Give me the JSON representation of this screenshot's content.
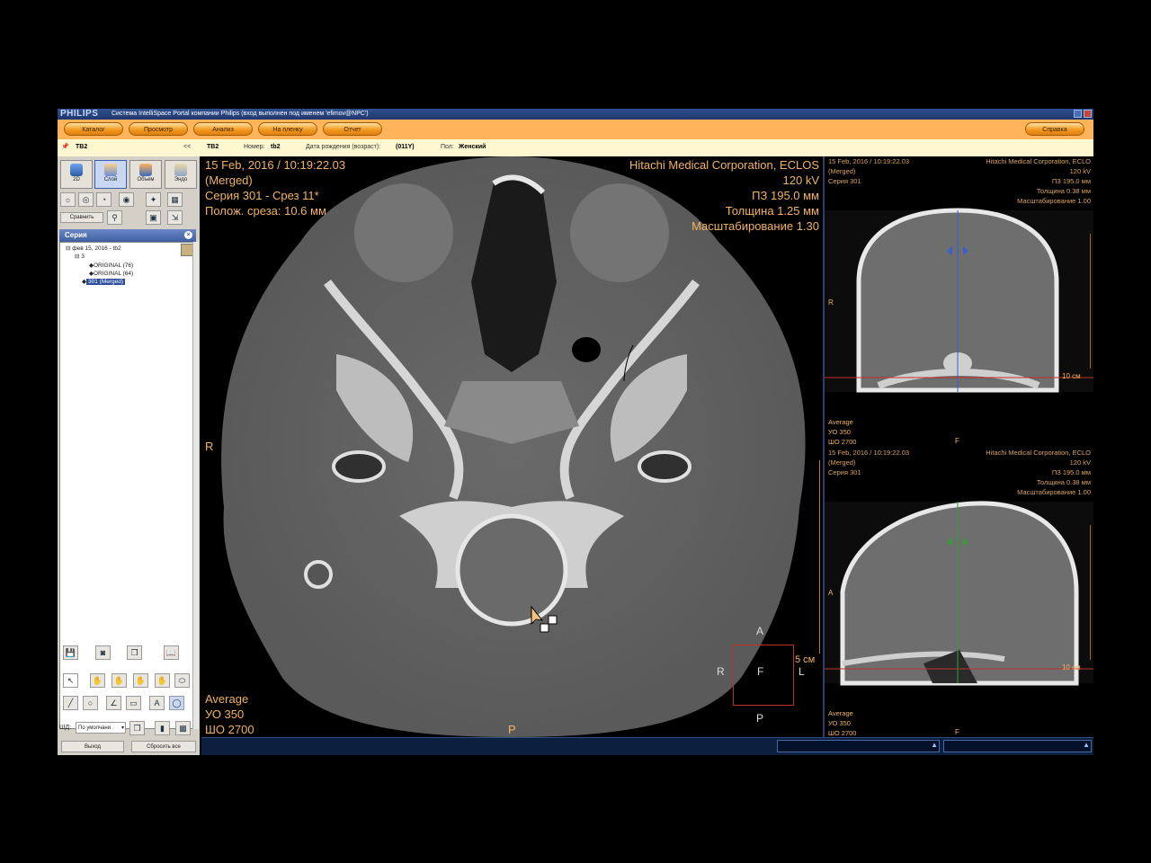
{
  "window": {
    "logo": "PHILIPS",
    "title": "Система IntelliSpace Portal компании Philips (вход выполнен под именем 'efimov@NPC')"
  },
  "nav": {
    "catalog": "Каталог",
    "view": "Просмотр",
    "analysis": "Анализ",
    "film": "На пленку",
    "report": "Отчет",
    "help": "Справка"
  },
  "patient": {
    "tab_name": "ТВ2",
    "collapse": "<<",
    "name": "ТВ2",
    "number_label": "Номер:",
    "number_value": "tb2",
    "dob_label": "Дата рождения (возраст):",
    "dob_value": "(011Y)",
    "sex_label": "Пол:",
    "sex_value": "Женский"
  },
  "left": {
    "modes": [
      "2D",
      "Слой",
      "Объем",
      "Эндо"
    ],
    "compare": "Сравнить",
    "series_title": "Серия",
    "tree": {
      "study": "фев 15, 2016 - tb2",
      "group": "3",
      "s1": "ORIGINAL (76)",
      "s2": "ORIGINAL (64)",
      "s3": "301 (Merged)"
    },
    "wl_label": "ШД:",
    "wl_select": "По умолчани",
    "exit": "Выход",
    "reset": "Сбросить все"
  },
  "main_view": {
    "tl": [
      "15 Feb, 2016 / 10:19:22.03",
      "(Merged)",
      "Серия 301 - Срез 11*",
      "Полож. среза: 10.6 мм"
    ],
    "tr": [
      "Hitachi Medical Corporation, ECLOS",
      "120 kV",
      "ПЗ 195.0 мм"
    ],
    "tr_links": [
      "Толщина 1.25 мм",
      "Масштабирование 1.30"
    ],
    "bl_links": [
      "Average",
      "УО   350",
      "ШО  2700"
    ],
    "orient_left": "R",
    "orient_bottom": "P",
    "scale_label": "5 см",
    "cube": {
      "a": "A",
      "r": "R",
      "f": "F",
      "l": "L",
      "p": "P"
    }
  },
  "side_top": {
    "tl": [
      "15 Feb, 2016 / 10:19:22.03",
      "(Merged)",
      "Серия 301"
    ],
    "tr": [
      "Hitachi Medical Corporation, ECLO",
      "120 kV",
      "ПЗ 195.0 мм"
    ],
    "tr_links": [
      "Толщина 0.38 мм",
      "Масштабирование 1.00"
    ],
    "bl_links": [
      "Average",
      "УО   350",
      "ШО  2700"
    ],
    "orient_left": "R",
    "orient_bottom": "F",
    "scale_label": "10 см"
  },
  "side_bottom": {
    "tl": [
      "15 Feb, 2016 / 10:19:22.03",
      "(Merged)",
      "Серия 301"
    ],
    "tr": [
      "Hitachi Medical Corporation, ECLO",
      "120 kV",
      "ПЗ 195.0 мм"
    ],
    "tr_links": [
      "Толщина 0.38 мм",
      "Масштабирование 1.00"
    ],
    "bl_links": [
      "Average",
      "УО   350",
      "ШО  2700"
    ],
    "orient_left": "A",
    "orient_bottom": "F",
    "scale_label": "10 см"
  }
}
